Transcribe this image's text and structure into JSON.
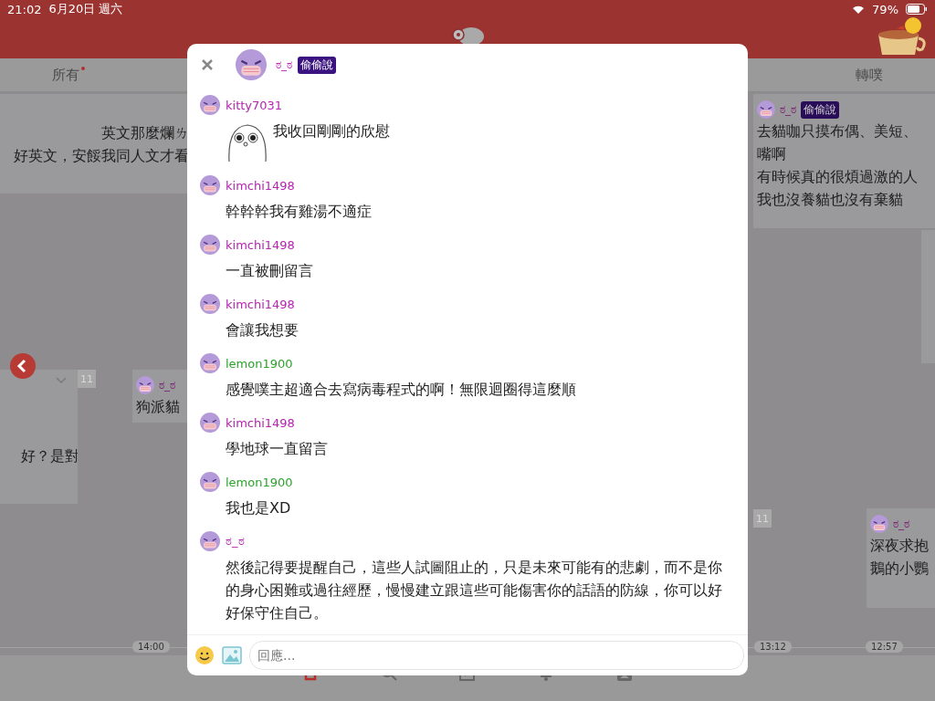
{
  "status_bar": {
    "time": "21:02",
    "date": "6月20日 週六",
    "battery": "79%"
  },
  "tabs": [
    {
      "label": "所有",
      "unread": true
    },
    {
      "label": "轉噗",
      "unread": false
    }
  ],
  "background_cards": [
    {
      "kind": "text",
      "lines": [
        "英文那麼爛ㄌ",
        "好英文，安餒我同人文才看"
      ]
    },
    {
      "kind": "collapsed",
      "lines": [
        "好？是對"
      ],
      "count": "11"
    },
    {
      "kind": "post",
      "user": "ಠ_ಠ",
      "lines": [
        "狗派貓"
      ]
    },
    {
      "kind": "post",
      "user": "ಠ_ಠ",
      "badge": "偷偷說",
      "lines": [
        "去貓咖只摸布偶、美短、",
        "嘴啊",
        "有時候真的很煩過激的人",
        "我也沒養貓也沒有棄貓"
      ]
    },
    {
      "kind": "blank"
    },
    {
      "kind": "count",
      "count": "11"
    },
    {
      "kind": "post",
      "user": "ಠ_ಠ",
      "lines": [
        "深夜求抱",
        "鵝的小鸚"
      ]
    }
  ],
  "timeline": [
    "14:00",
    "13:12",
    "12:57"
  ],
  "dialog": {
    "user": "ಠ_ಠ",
    "badge": "偷偷說",
    "responses": [
      {
        "user": "kitty7031",
        "color": "#b523b0",
        "kind": "sticker",
        "text": "我收回剛剛的欣慰"
      },
      {
        "user": "kimchi1498",
        "color": "#b523b0",
        "kind": "text",
        "text": "幹幹幹我有雞湯不適症"
      },
      {
        "user": "kimchi1498",
        "color": "#b523b0",
        "kind": "text",
        "text": "一直被刪留言"
      },
      {
        "user": "kimchi1498",
        "color": "#b523b0",
        "kind": "text",
        "text": "會讓我想要"
      },
      {
        "user": "lemon1900",
        "color": "#2ba32b",
        "kind": "text",
        "text": "感覺噗主超適合去寫病毒程式的啊！無限迴圈得這麼順"
      },
      {
        "user": "kimchi1498",
        "color": "#b523b0",
        "kind": "text",
        "text": "學地球一直留言"
      },
      {
        "user": "lemon1900",
        "color": "#2ba32b",
        "kind": "text",
        "text": "我也是XD"
      },
      {
        "user": "ಠ_ಠ",
        "color": "#b523b0",
        "kind": "text",
        "text": "然後記得要提醒自己，這些人試圖阻止的，只是未來可能有的悲劇，而不是你的身心困難或過往經歷，慢慢建立跟這些可能傷害你的話語的防線，你可以好好保守住自己。"
      }
    ],
    "reply_placeholder": "回應..."
  }
}
